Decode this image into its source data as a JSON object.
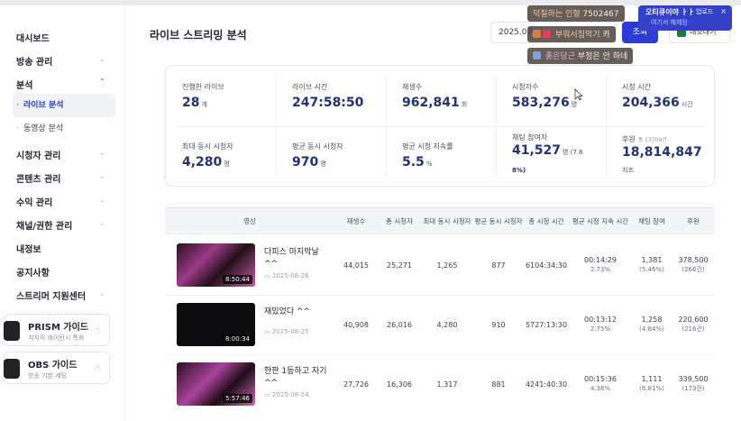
{
  "sidebar": {
    "items": [
      {
        "label": "대시보드",
        "chevron": false
      },
      {
        "label": "방송 관리",
        "chevron": true
      },
      {
        "label": "분석",
        "chevron": true,
        "expanded": true
      },
      {
        "label": "시청자 관리",
        "chevron": true
      },
      {
        "label": "콘텐츠 관리",
        "chevron": true
      },
      {
        "label": "수익 관리",
        "chevron": true
      },
      {
        "label": "채널/권한 관리",
        "chevron": true
      },
      {
        "label": "내정보",
        "chevron": false
      },
      {
        "label": "공지사항",
        "chevron": false
      },
      {
        "label": "스트리머 지원센터",
        "chevron": true
      }
    ],
    "subitems": [
      {
        "label": "라이브 분석",
        "active": true
      },
      {
        "label": "동영상 분석",
        "active": false
      }
    ],
    "guides": [
      {
        "title": "PRISM 가이드",
        "subtitle": "치지직 레이턴시 특화"
      },
      {
        "title": "OBS 가이드",
        "subtitle": "방송 기본 세팅"
      }
    ]
  },
  "header": {
    "title": "라이브 스트리밍 분석",
    "date_value": "2025.07",
    "query_label": "조회",
    "excel_label": "내보내기"
  },
  "stats": [
    {
      "label": "진행한 라이브",
      "value": "28",
      "unit": "개"
    },
    {
      "label": "라이브 시간",
      "value": "247:58:50",
      "unit": ""
    },
    {
      "label": "재생수",
      "value": "962,841",
      "unit": "회"
    },
    {
      "label": "시청자수",
      "value": "583,276",
      "unit": "명"
    },
    {
      "label": "시청 시간",
      "value": "204,366",
      "unit": "시간"
    },
    {
      "label": "최대 동시 시청자",
      "value": "4,280",
      "unit": "명"
    },
    {
      "label": "평균 동시 시청자",
      "value": "970",
      "unit": "명"
    },
    {
      "label": "평균 시청 지속률",
      "value": "5.5",
      "unit": "%"
    },
    {
      "label": "채팅 참여자",
      "value": "41,527",
      "unit": "명 (7.6",
      "value2": "8%)"
    },
    {
      "label": "후원",
      "label_sub": "총 13709건",
      "value": "18,814,847",
      "unit": "",
      "value2": "치즈"
    }
  ],
  "table": {
    "headers": [
      "영상",
      "재생수",
      "총 시청자",
      "최대 동시 시청자",
      "평균 동시 시청자",
      "총 시청 시간",
      "평균 시청 지속 시간",
      "채팅 참여",
      "후원"
    ],
    "rows": [
      {
        "title": "다피스 마지막날 ^^",
        "date": "2025-08-26",
        "duration": "8:50:44",
        "plays": "44,015",
        "viewers": "25,271",
        "max_cc": "1,265",
        "avg_cc": "877",
        "watch_time": "6104:34:30",
        "avg_duration": "00:14:29",
        "avg_pct": "2.73%",
        "chat": "1,381",
        "chat_pct": "(5.46%)",
        "donation": "378,500",
        "donation_cnt": "(266건)"
      },
      {
        "title": "재밌었다 ^^",
        "date": "2025-08-25",
        "duration": "8:00:34",
        "plays": "40,908",
        "viewers": "26,016",
        "max_cc": "4,280",
        "avg_cc": "910",
        "watch_time": "5727:13:30",
        "avg_duration": "00:13:12",
        "avg_pct": "2.75%",
        "chat": "1,258",
        "chat_pct": "(4.84%)",
        "donation": "220,600",
        "donation_cnt": "(216건)"
      },
      {
        "title": "한판 1등하고 자기 ^^",
        "date": "2025-08-24",
        "duration": "5:57:46",
        "plays": "27,726",
        "viewers": "16,306",
        "max_cc": "1,317",
        "avg_cc": "881",
        "watch_time": "4241:40:30",
        "avg_duration": "00:15:36",
        "avg_pct": "4.36%",
        "chat": "1,111",
        "chat_pct": "(6.81%)",
        "donation": "339,500",
        "donation_cnt": "(173건)"
      }
    ]
  },
  "chat_overlay": [
    {
      "nick": "덕질하는 인형",
      "text": "7502467"
    },
    {
      "nick": "부워서집먹기",
      "text": "카"
    },
    {
      "nick": "좋은당근",
      "text": "부정은 안 하네"
    }
  ],
  "popup": {
    "title": "오티큐이야 ㅏㅏ",
    "subtitle": "여기서 해제된",
    "extra": "업로드",
    "close": "×"
  },
  "colors": {
    "accent": "#2c3bd6",
    "value_text": "#23307a",
    "chat_bg": "#3c3228"
  }
}
